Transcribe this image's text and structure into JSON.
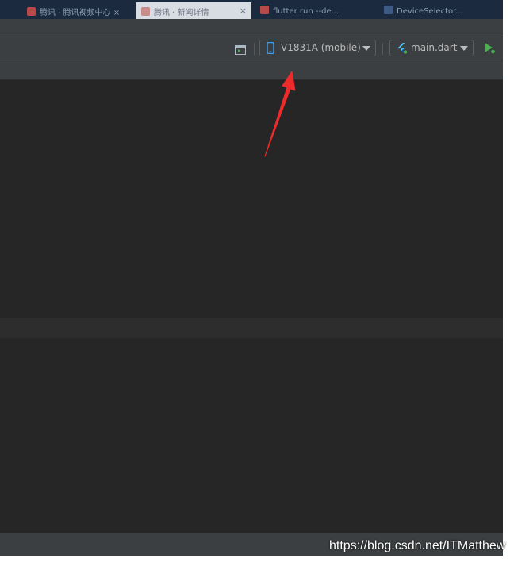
{
  "browser_tabs": [
    {
      "label": "腾讯 · 腾讯视频中心 ×"
    },
    {
      "label": "腾讯 · 新闻详情"
    },
    {
      "label": "flutter run --de..."
    },
    {
      "label": "DeviceSelector..."
    }
  ],
  "toolbar": {
    "device_selector": "V1831A (mobile)",
    "run_config": "main.dart"
  },
  "watermark": "https://blog.csdn.net/ITMatthew",
  "colors": {
    "ide_background": "#262626",
    "panel": "#3c3f41",
    "device_icon": "#3d9be9",
    "run_icon": "#4fae55",
    "annotation_arrow": "#ee2b2b"
  }
}
